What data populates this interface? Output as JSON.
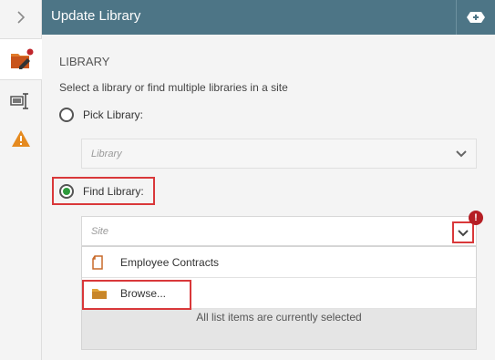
{
  "header": {
    "title": "Update Library"
  },
  "rail": {
    "expand_icon": "chevron-right-icon",
    "items": [
      {
        "icon": "library-edit-icon",
        "active": true
      },
      {
        "icon": "text-field-icon",
        "active": false
      },
      {
        "icon": "warning-icon",
        "active": false
      }
    ]
  },
  "section": {
    "title": "LIBRARY",
    "description": "Select a library or find multiple libraries in a site"
  },
  "pick_library": {
    "label": "Pick Library:",
    "selected": false,
    "placeholder": "Library"
  },
  "find_library": {
    "label": "Find Library:",
    "selected": true,
    "placeholder": "Site",
    "error_badge": "!"
  },
  "results": {
    "items": [
      {
        "label": "Employee Contracts",
        "icon": "document-icon"
      },
      {
        "label": "Browse...",
        "icon": "folder-icon"
      }
    ],
    "status": "All list items are currently selected"
  },
  "colors": {
    "header": "#4d7586",
    "accent_red": "#d9383a",
    "radio_selected": "#2e9a3c",
    "warning": "#e58a1f",
    "folder": "#e0a33a"
  }
}
